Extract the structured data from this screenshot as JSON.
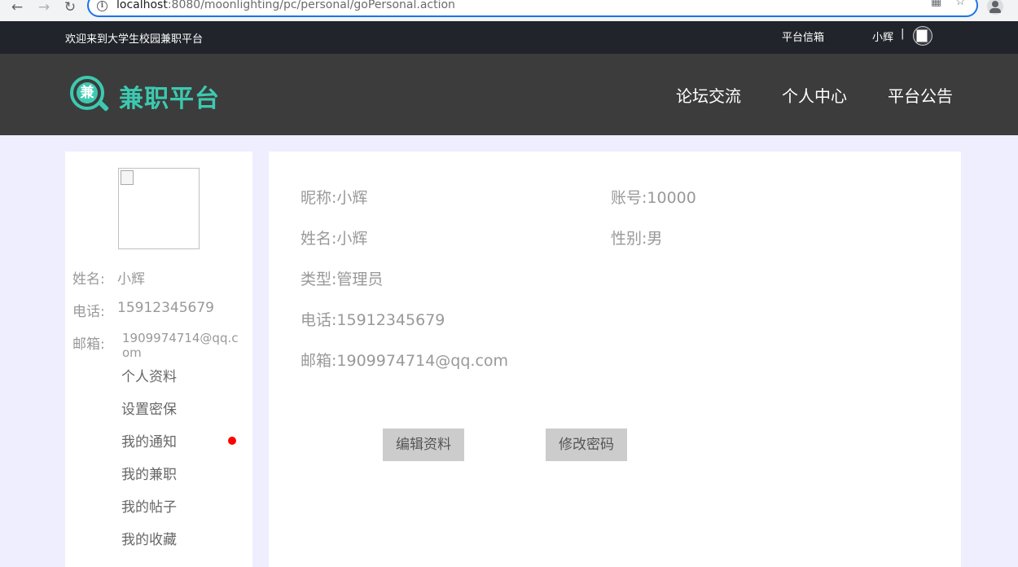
{
  "browser": {
    "url_host": "localhost",
    "url_rest": ":8080/moonlighting/pc/personal/goPersonal.action",
    "back": "←",
    "forward": "→",
    "reload": "↻",
    "info": "i",
    "qr": "▦",
    "star": "☆"
  },
  "topbar": {
    "welcome": "欢迎来到大学生校园兼职平台",
    "mailbox": "平台信箱",
    "username": "小辉",
    "separator": "|"
  },
  "header": {
    "logo_char": "兼",
    "logo_text": "兼职平台",
    "nav": [
      "论坛交流",
      "个人中心",
      "平台公告"
    ]
  },
  "sidebar": {
    "name_label": "姓名:",
    "name_value": "小辉",
    "phone_label": "电话:",
    "phone_value": "15912345679",
    "email_label": "邮箱:",
    "email_value": "1909974714@qq.com",
    "menu": [
      "个人资料",
      "设置密保",
      "我的通知",
      "我的兼职",
      "我的帖子",
      "我的收藏"
    ]
  },
  "profile": {
    "nickname_label": "昵称:",
    "nickname_value": "小辉",
    "account_label": "账号:",
    "account_value": "10000",
    "realname_label": "姓名:",
    "realname_value": "小辉",
    "gender_label": "性别:",
    "gender_value": "男",
    "type_label": "类型:",
    "type_value": "管理员",
    "phone_label": "电话:",
    "phone_value": "15912345679",
    "email_label": "邮箱:",
    "email_value": "1909974714@qq.com"
  },
  "buttons": {
    "edit": "编辑资料",
    "change_password": "修改密码"
  },
  "colors": {
    "brand": "#3cc9b0",
    "topbar": "#21242b",
    "header": "#3c3c3c",
    "page_bg": "#eeeeff",
    "notify": "#ff0000"
  }
}
